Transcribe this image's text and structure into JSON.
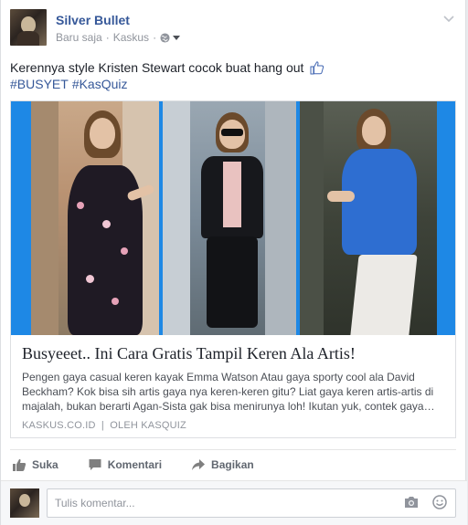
{
  "post": {
    "author": "Silver Bullet",
    "time": "Baru saja",
    "separator": "·",
    "source": "Kaskus",
    "status_text": "Kerennya style Kristen Stewart cocok buat hang out",
    "hashtags": [
      "#BUSYET",
      "#KasQuiz"
    ]
  },
  "link_card": {
    "title": "Busyeeet.. Ini Cara Gratis Tampil Keren Ala Artis!",
    "description": "Pengen gaya casual keren kayak Emma Watson Atau gaya sporty cool ala David Beckham? Kok bisa sih artis gaya nya keren-keren gitu? Liat gaya keren artis-artis di majalah, bukan berarti Agan-Sista gak bisa menirunya loh! Ikutan yuk, contek gaya…",
    "domain": "KASKUS.CO.ID",
    "divider": "|",
    "by": "OLEH KASQUIZ"
  },
  "actions": {
    "like": "Suka",
    "comment": "Komentari",
    "share": "Bagikan"
  },
  "comment_box": {
    "placeholder": "Tulis komentar..."
  },
  "colors": {
    "link": "#365899",
    "image_border": "#1e88e5",
    "muted": "#90949c"
  },
  "icons": [
    "chevron-down-icon",
    "globe-icon",
    "thumbs-up-icon",
    "like-icon",
    "comment-icon",
    "share-icon",
    "camera-icon",
    "smiley-icon"
  ]
}
